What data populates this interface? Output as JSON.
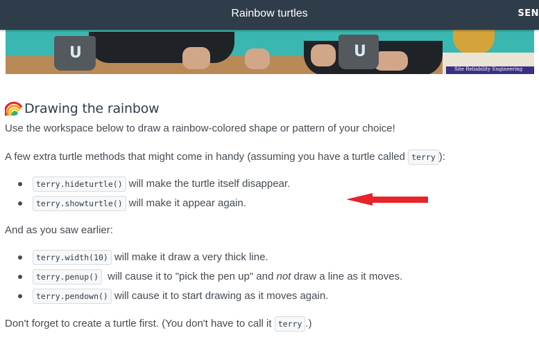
{
  "header": {
    "title": "Rainbow turtles",
    "send_label": "SEN"
  },
  "banner": {
    "mug_logo": "U",
    "book_text": "Site Reliability Engineering"
  },
  "content": {
    "heading": "Drawing the rainbow",
    "heading_icon": "rainbow-icon",
    "intro": "Use the workspace below to draw a rainbow-colored shape or pattern of your choice!",
    "methods_intro": "A few extra turtle methods that might come in handy (assuming you have a turtle called ",
    "methods_intro_code": "terry",
    "methods_intro_end": "):",
    "methods": [
      {
        "code": "terry.hideturtle()",
        "text": " will make the turtle itself disappear."
      },
      {
        "code": "terry.showturtle()",
        "text": " will make it appear again."
      }
    ],
    "earlier_intro": "And as you saw earlier:",
    "earlier": [
      {
        "code": "terry.width(10)",
        "text": " will make it draw a very thick line."
      },
      {
        "code": "terry.penup()",
        "text_before": " will cause it to \"pick the pen up\" and ",
        "emph": "not",
        "text_after": " draw a line as it moves."
      },
      {
        "code": "terry.pendown()",
        "text": " will cause it to start drawing as it moves again."
      }
    ],
    "footer_before": "Don't forget to create a turtle first. (You don't have to call it ",
    "footer_code": "terry",
    "footer_after": ".)"
  },
  "annotation": {
    "arrow_color": "#e8232a"
  }
}
